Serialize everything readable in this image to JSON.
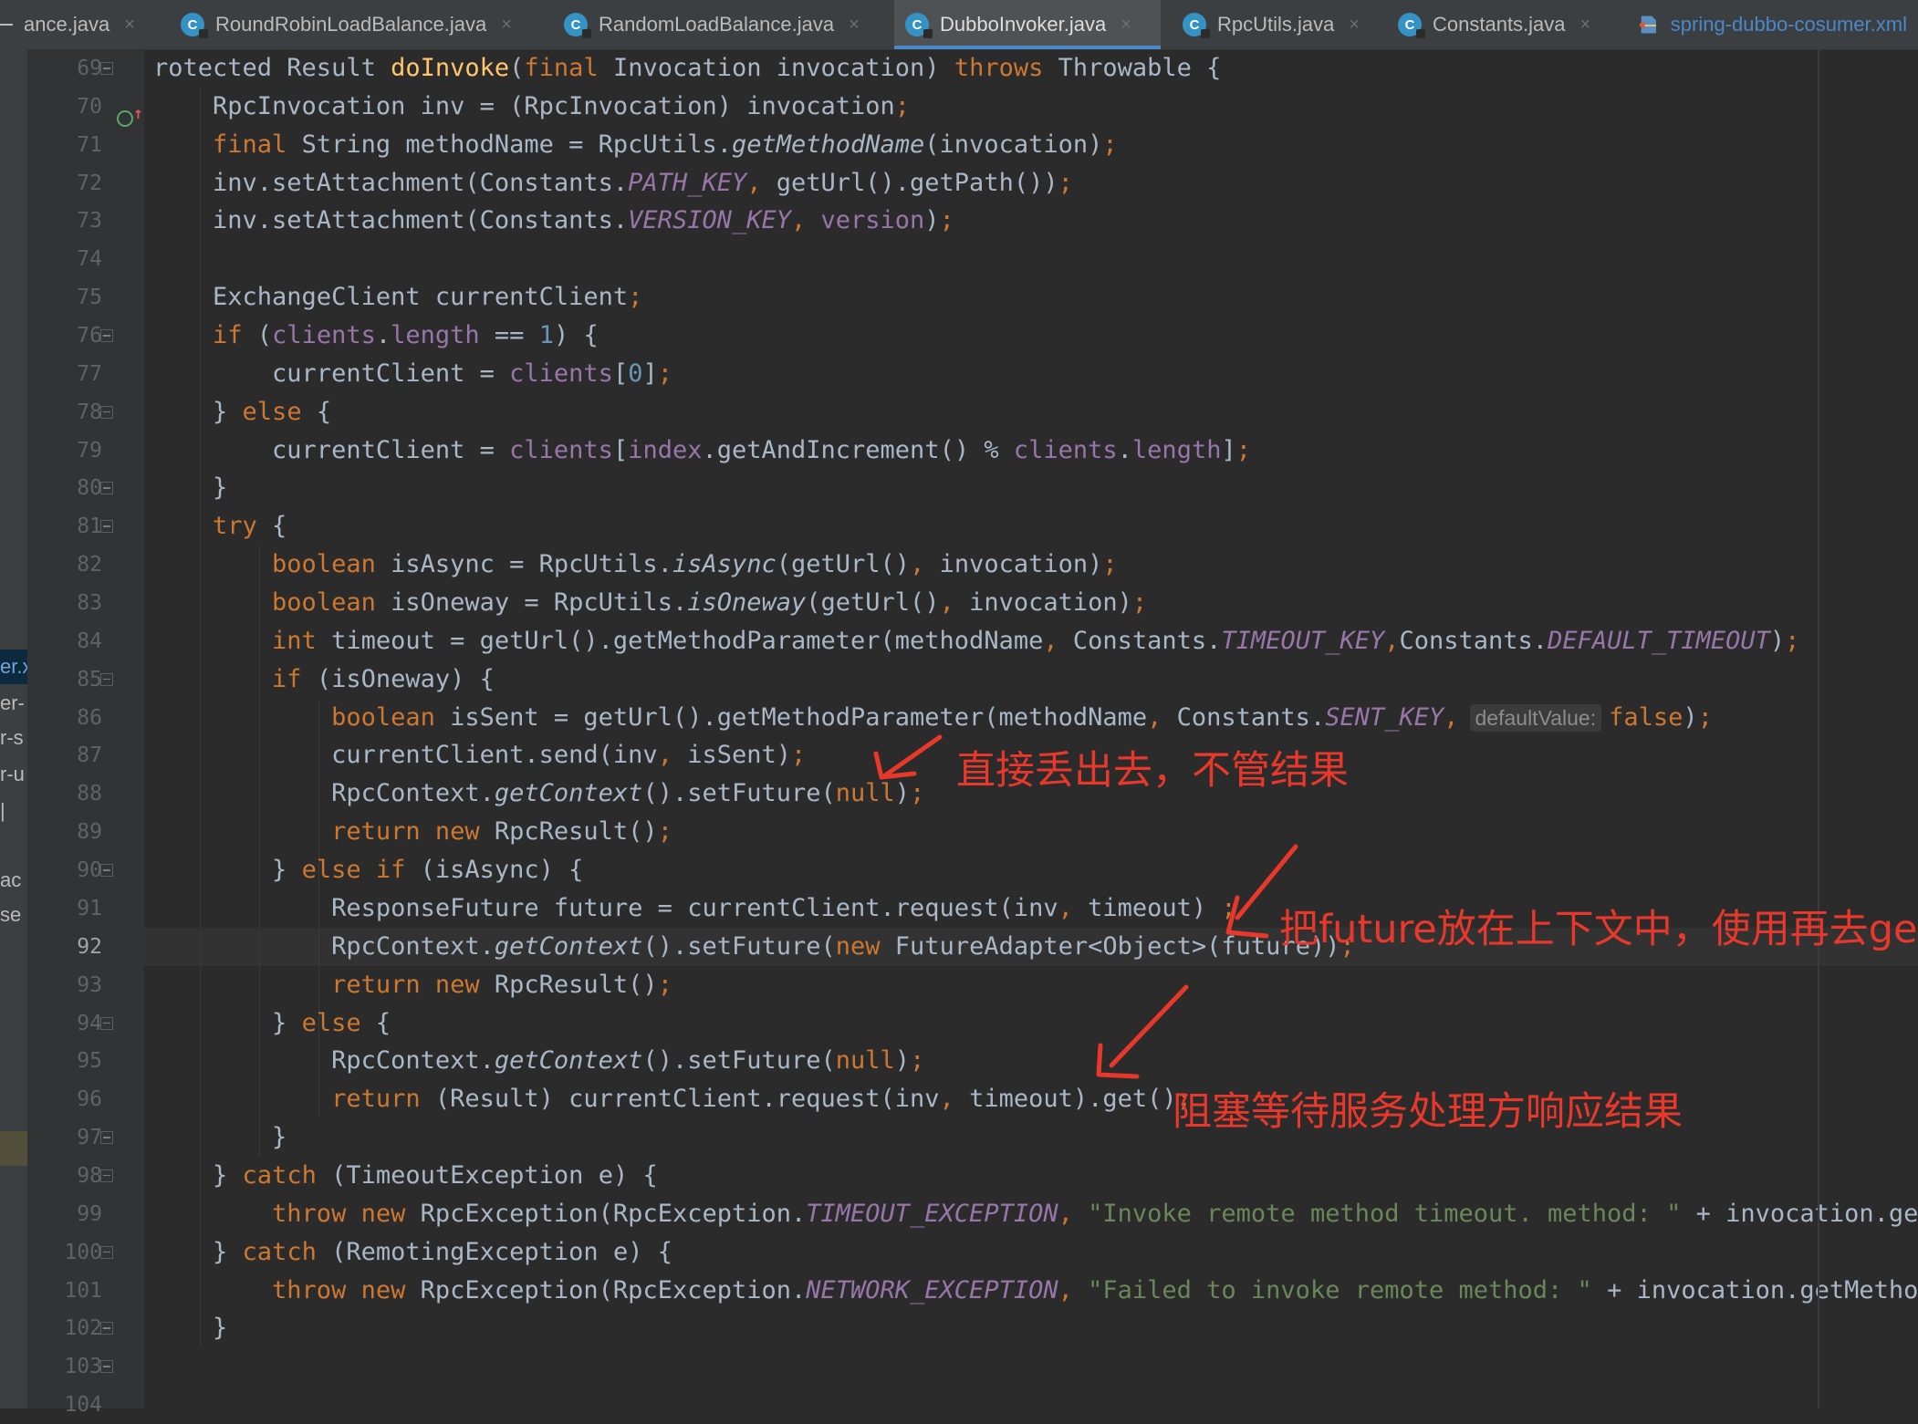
{
  "tabs": [
    {
      "label": "ance.java",
      "icon": "none",
      "active": false
    },
    {
      "label": "RoundRobinLoadBalance.java",
      "icon": "java-class-icon",
      "active": false
    },
    {
      "label": "RandomLoadBalance.java",
      "icon": "java-class-icon",
      "active": false
    },
    {
      "label": "DubboInvoker.java",
      "icon": "java-class-icon",
      "active": true
    },
    {
      "label": "RpcUtils.java",
      "icon": "java-class-icon",
      "active": false
    },
    {
      "label": "Constants.java",
      "icon": "java-class-icon",
      "active": false
    },
    {
      "label": "spring-dubbo-cosumer.xml",
      "icon": "xml-file-icon",
      "active": false
    }
  ],
  "tab_close_glyph": "×",
  "class_icon_letter": "C",
  "left_strip_fragments": [
    "er.x",
    "er-",
    "r-s",
    "r-u",
    "|",
    "ac",
    "se"
  ],
  "current_line": 92,
  "lines": [
    {
      "n": 69,
      "segs": [
        [
          "",
          "rotected Result "
        ],
        [
          "fn",
          "doInvoke"
        ],
        [
          "",
          "("
        ],
        [
          "kw",
          "final "
        ],
        [
          "",
          "Invocation invocation) "
        ],
        [
          "kw",
          "throws "
        ],
        [
          "",
          "Throwable {"
        ]
      ]
    },
    {
      "n": 70,
      "segs": [
        [
          "",
          "    RpcInvocation inv = (RpcInvocation) invocation"
        ],
        [
          "kw",
          ";"
        ]
      ]
    },
    {
      "n": 71,
      "segs": [
        [
          "kw",
          "    final "
        ],
        [
          "",
          "String methodName = RpcUtils."
        ],
        [
          "itc",
          "getMethodName"
        ],
        [
          "",
          "(invocation)"
        ],
        [
          "kw",
          ";"
        ]
      ]
    },
    {
      "n": 72,
      "segs": [
        [
          "",
          "    inv.setAttachment(Constants."
        ],
        [
          "cst",
          "PATH_KEY"
        ],
        [
          "kw",
          ", "
        ],
        [
          "",
          "getUrl().getPath())"
        ],
        [
          "kw",
          ";"
        ]
      ]
    },
    {
      "n": 73,
      "segs": [
        [
          "",
          "    inv.setAttachment(Constants."
        ],
        [
          "cst",
          "VERSION_KEY"
        ],
        [
          "kw",
          ", "
        ],
        [
          "fld",
          "version"
        ],
        [
          "",
          ")"
        ],
        [
          "kw",
          ";"
        ]
      ]
    },
    {
      "n": 74,
      "segs": []
    },
    {
      "n": 75,
      "segs": [
        [
          "",
          "    ExchangeClient currentClient"
        ],
        [
          "kw",
          ";"
        ]
      ]
    },
    {
      "n": 76,
      "segs": [
        [
          "kw",
          "    if "
        ],
        [
          "",
          "("
        ],
        [
          "fld",
          "clients"
        ],
        [
          "",
          "."
        ],
        [
          "fld",
          "length "
        ],
        [
          "",
          "== "
        ],
        [
          "num",
          "1"
        ],
        [
          "",
          ") {"
        ]
      ]
    },
    {
      "n": 77,
      "segs": [
        [
          "",
          "        currentClient = "
        ],
        [
          "fld",
          "clients"
        ],
        [
          "",
          "["
        ],
        [
          "num",
          "0"
        ],
        [
          "",
          "]"
        ],
        [
          "kw",
          ";"
        ]
      ]
    },
    {
      "n": 78,
      "segs": [
        [
          "",
          "    } "
        ],
        [
          "kw",
          "else "
        ],
        [
          "",
          "{"
        ]
      ]
    },
    {
      "n": 79,
      "segs": [
        [
          "",
          "        currentClient = "
        ],
        [
          "fld",
          "clients"
        ],
        [
          "",
          "["
        ],
        [
          "fld",
          "index"
        ],
        [
          "",
          ".getAndIncrement() % "
        ],
        [
          "fld",
          "clients"
        ],
        [
          "",
          "."
        ],
        [
          "fld",
          "length"
        ],
        [
          "",
          "]"
        ],
        [
          "kw",
          ";"
        ]
      ]
    },
    {
      "n": 80,
      "segs": [
        [
          "",
          "    }"
        ]
      ]
    },
    {
      "n": 81,
      "segs": [
        [
          "kw",
          "    try "
        ],
        [
          "",
          "{"
        ]
      ]
    },
    {
      "n": 82,
      "segs": [
        [
          "kw",
          "        boolean "
        ],
        [
          "",
          "isAsync = RpcUtils."
        ],
        [
          "itc",
          "isAsync"
        ],
        [
          "",
          "(getUrl()"
        ],
        [
          "kw",
          ", "
        ],
        [
          "",
          "invocation)"
        ],
        [
          "kw",
          ";"
        ]
      ]
    },
    {
      "n": 83,
      "segs": [
        [
          "kw",
          "        boolean "
        ],
        [
          "",
          "isOneway = RpcUtils."
        ],
        [
          "itc",
          "isOneway"
        ],
        [
          "",
          "(getUrl()"
        ],
        [
          "kw",
          ", "
        ],
        [
          "",
          "invocation)"
        ],
        [
          "kw",
          ";"
        ]
      ]
    },
    {
      "n": 84,
      "segs": [
        [
          "kw",
          "        int "
        ],
        [
          "",
          "timeout = getUrl().getMethodParameter(methodName"
        ],
        [
          "kw",
          ", "
        ],
        [
          "",
          "Constants."
        ],
        [
          "cst",
          "TIMEOUT_KEY"
        ],
        [
          "kw",
          ","
        ],
        [
          "",
          "Constants."
        ],
        [
          "cst",
          "DEFAULT_TIMEOUT"
        ],
        [
          "",
          ")"
        ],
        [
          "kw",
          ";"
        ]
      ]
    },
    {
      "n": 85,
      "segs": [
        [
          "kw",
          "        if "
        ],
        [
          "",
          "(isOneway) {"
        ]
      ]
    },
    {
      "n": 86,
      "segs": [
        [
          "kw",
          "            boolean "
        ],
        [
          "",
          "isSent = getUrl().getMethodParameter(methodName"
        ],
        [
          "kw",
          ", "
        ],
        [
          "",
          "Constants."
        ],
        [
          "cst",
          "SENT_KEY"
        ],
        [
          "kw",
          ","
        ],
        [
          "hint",
          "defaultValue:"
        ],
        [
          "kw",
          "false"
        ],
        [
          "",
          ")"
        ],
        [
          "kw",
          ";"
        ]
      ]
    },
    {
      "n": 87,
      "segs": [
        [
          "",
          "            currentClient.send(inv"
        ],
        [
          "kw",
          ", "
        ],
        [
          "",
          "isSent)"
        ],
        [
          "kw",
          ";"
        ]
      ]
    },
    {
      "n": 88,
      "segs": [
        [
          "",
          "            RpcContext."
        ],
        [
          "itc",
          "getContext"
        ],
        [
          "",
          "().setFuture("
        ],
        [
          "kw",
          "null"
        ],
        [
          "",
          ")"
        ],
        [
          "kw",
          ";"
        ]
      ]
    },
    {
      "n": 89,
      "segs": [
        [
          "kw",
          "            return new "
        ],
        [
          "",
          "RpcResult()"
        ],
        [
          "kw",
          ";"
        ]
      ]
    },
    {
      "n": 90,
      "segs": [
        [
          "",
          "        } "
        ],
        [
          "kw",
          "else if "
        ],
        [
          "",
          "(isAsync) {"
        ]
      ]
    },
    {
      "n": 91,
      "segs": [
        [
          "",
          "            ResponseFuture future = currentClient.request(inv"
        ],
        [
          "kw",
          ", "
        ],
        [
          "",
          "timeout) "
        ],
        [
          "kw",
          ";"
        ]
      ]
    },
    {
      "n": 92,
      "segs": [
        [
          "",
          "            RpcContext."
        ],
        [
          "itc",
          "getContext"
        ],
        [
          "",
          "().setFuture("
        ],
        [
          "kw",
          "new "
        ],
        [
          "",
          "FutureAdapter<Object>(future))"
        ],
        [
          "kw",
          ";"
        ]
      ]
    },
    {
      "n": 93,
      "segs": [
        [
          "kw",
          "            return new "
        ],
        [
          "",
          "RpcResult()"
        ],
        [
          "kw",
          ";"
        ]
      ]
    },
    {
      "n": 94,
      "segs": [
        [
          "",
          "        } "
        ],
        [
          "kw",
          "else "
        ],
        [
          "",
          "{"
        ]
      ]
    },
    {
      "n": 95,
      "segs": [
        [
          "",
          "            RpcContext."
        ],
        [
          "itc",
          "getContext"
        ],
        [
          "",
          "().setFuture("
        ],
        [
          "kw",
          "null"
        ],
        [
          "",
          ")"
        ],
        [
          "kw",
          ";"
        ]
      ]
    },
    {
      "n": 96,
      "segs": [
        [
          "kw",
          "            return "
        ],
        [
          "",
          "(Result) currentClient.request(inv"
        ],
        [
          "kw",
          ", "
        ],
        [
          "",
          "timeout).get()"
        ],
        [
          "kw",
          ";"
        ]
      ]
    },
    {
      "n": 97,
      "segs": [
        [
          "",
          "        }"
        ]
      ]
    },
    {
      "n": 98,
      "segs": [
        [
          "",
          "    } "
        ],
        [
          "kw",
          "catch "
        ],
        [
          "",
          "(TimeoutException e) {"
        ]
      ]
    },
    {
      "n": 99,
      "segs": [
        [
          "kw",
          "        throw new "
        ],
        [
          "",
          "RpcException(RpcException."
        ],
        [
          "cst",
          "TIMEOUT_EXCEPTION"
        ],
        [
          "kw",
          ", "
        ],
        [
          "str",
          "\"Invoke remote method timeout. method: \" "
        ],
        [
          "",
          "+ invocation.getMethodName()"
        ]
      ]
    },
    {
      "n": 100,
      "segs": [
        [
          "",
          "    } "
        ],
        [
          "kw",
          "catch "
        ],
        [
          "",
          "(RemotingException e) {"
        ]
      ]
    },
    {
      "n": 101,
      "segs": [
        [
          "kw",
          "        throw new "
        ],
        [
          "",
          "RpcException(RpcException."
        ],
        [
          "cst",
          "NETWORK_EXCEPTION"
        ],
        [
          "kw",
          ", "
        ],
        [
          "str",
          "\"Failed to invoke remote method: \" "
        ],
        [
          "",
          "+ invocation.getMethodName()"
        ]
      ]
    },
    {
      "n": 102,
      "segs": [
        [
          "",
          "    }"
        ]
      ]
    },
    {
      "n": 103,
      "segs": []
    },
    {
      "n": 104,
      "segs": []
    }
  ],
  "fold_markers": [
    {
      "line": 69,
      "kind": "open"
    },
    {
      "line": 76,
      "kind": "open"
    },
    {
      "line": 78,
      "kind": "close"
    },
    {
      "line": 80,
      "kind": "close"
    },
    {
      "line": 81,
      "kind": "open"
    },
    {
      "line": 85,
      "kind": "open"
    },
    {
      "line": 90,
      "kind": "open"
    },
    {
      "line": 94,
      "kind": "open"
    },
    {
      "line": 97,
      "kind": "close"
    },
    {
      "line": 98,
      "kind": "open"
    },
    {
      "line": 100,
      "kind": "open"
    },
    {
      "line": 102,
      "kind": "close"
    },
    {
      "line": 103,
      "kind": "close"
    }
  ],
  "annotations": {
    "oneway": "直接丢出去，不管结果",
    "async": "把future放在上下文中，使用再去get",
    "sync": "阻塞等待服务处理方响应结果"
  },
  "colors": {
    "annotation": "#e8382b",
    "keyword": "#cc7832",
    "method_decl": "#ffc66d",
    "field": "#9876aa",
    "number": "#6897bb",
    "string": "#6a8759",
    "text": "#a9b7c6",
    "background": "#2b2b2b"
  }
}
